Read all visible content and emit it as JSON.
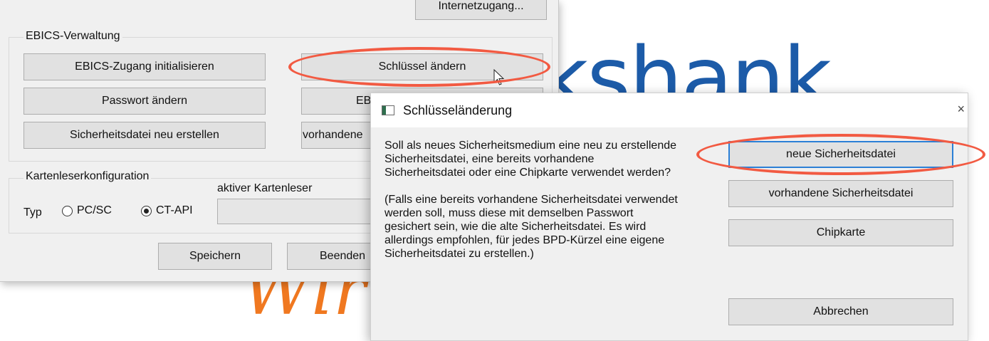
{
  "background": {
    "brand_text": "kshank",
    "brand_slogan": "Wir",
    "colors": {
      "brand_blue": "#1c5ba8",
      "brand_orange": "#f07820"
    }
  },
  "main_window": {
    "top_button": "Internetzugang...",
    "ebics_group": {
      "title": "EBICS-Verwaltung",
      "buttons": {
        "init": "EBICS-Zugang initialisieren",
        "change_key": "Schlüssel ändern",
        "change_password": "Passwort ändern",
        "ebics_partial": "EBI",
        "recreate_file": "Sicherheitsdatei neu erstellen",
        "existing_partial": "vorhandene"
      }
    },
    "card_reader_group": {
      "title": "Kartenleserkonfiguration",
      "type_label": "Typ",
      "radio_options": [
        "PC/SC",
        "CT-API"
      ],
      "selected": "CT-API",
      "active_reader_label": "aktiver Kartenleser",
      "active_reader_value": ""
    },
    "buttons": {
      "save": "Speichern",
      "exit": "Beenden"
    }
  },
  "dialog": {
    "title": "Schlüsseländerung",
    "close_symbol": "×",
    "message": "Soll als neues Sicherheitsmedium eine neu zu erstellende\nSicherheitsdatei, eine bereits vorhandene\nSicherheitsdatei oder eine Chipkarte verwendet werden?\n\n(Falls eine bereits vorhandene Sicherheitsdatei verwendet\nwerden soll, muss diese mit demselben Passwort\ngesichert sein, wie die alte Sicherheitsdatei. Es wird\nallerdings empfohlen, für jedes BPD-Kürzel eine eigene\nSicherheitsdatei zu erstellen.)",
    "buttons": {
      "new_file": "neue Sicherheitsdatei",
      "existing_file": "vorhandene Sicherheitsdatei",
      "chipcard": "Chipkarte",
      "cancel": "Abbrechen"
    }
  },
  "annotations": {
    "highlight_color": "#f25a42"
  }
}
